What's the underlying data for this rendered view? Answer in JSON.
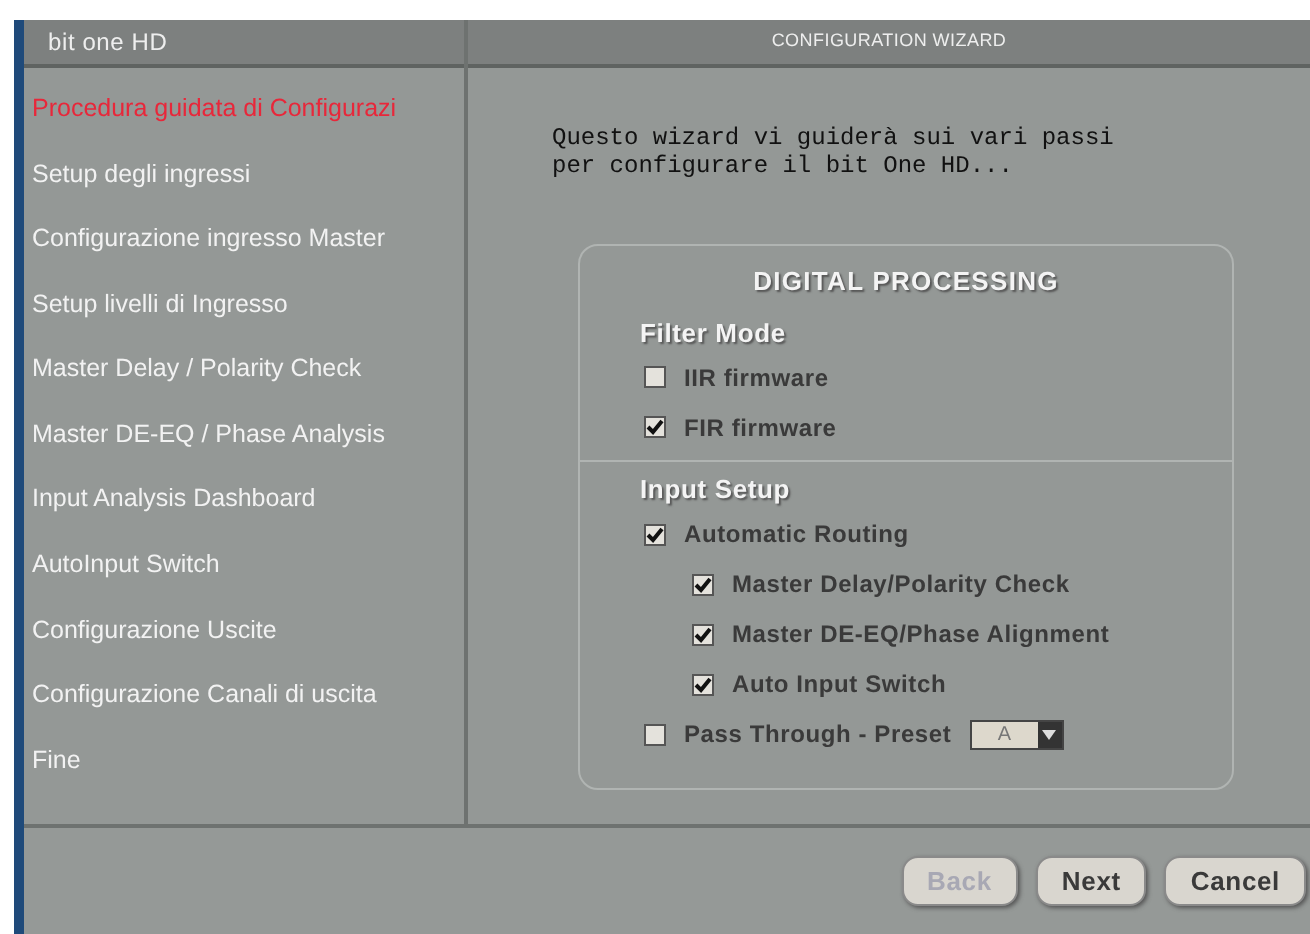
{
  "app_title": "bit one HD",
  "window": {
    "title": "CONFIGURATION WIZARD"
  },
  "sidebar": {
    "items": [
      {
        "label": "Procedura guidata di Configurazi",
        "selected": true
      },
      {
        "label": "Setup degli ingressi",
        "selected": false
      },
      {
        "label": "Configurazione ingresso Master",
        "selected": false
      },
      {
        "label": "Setup livelli di Ingresso",
        "selected": false
      },
      {
        "label": "Master Delay / Polarity Check",
        "selected": false
      },
      {
        "label": "Master DE-EQ / Phase Analysis",
        "selected": false
      },
      {
        "label": "Input Analysis Dashboard",
        "selected": false
      },
      {
        "label": "AutoInput Switch",
        "selected": false
      },
      {
        "label": "Configurazione Uscite",
        "selected": false
      },
      {
        "label": "Configurazione Canali di uscita",
        "selected": false
      },
      {
        "label": "Fine",
        "selected": false
      }
    ]
  },
  "intro": [
    "Questo wizard vi guiderà sui vari passi",
    "per configurare il bit One HD..."
  ],
  "panel": {
    "title": "DIGITAL PROCESSING",
    "sections": [
      {
        "title": "Filter Mode",
        "options": [
          {
            "label": "IIR firmware",
            "checked": false
          },
          {
            "label": "FIR firmware",
            "checked": true
          }
        ]
      },
      {
        "title": "Input Setup",
        "options": [
          {
            "label": "Automatic Routing",
            "checked": true,
            "children": [
              {
                "label": "Master Delay/Polarity Check",
                "checked": true
              },
              {
                "label": "Master DE-EQ/Phase Alignment",
                "checked": true
              },
              {
                "label": "Auto Input Switch",
                "checked": true
              }
            ]
          },
          {
            "label": "Pass Through - Preset",
            "checked": false,
            "dropdown": {
              "value": "A"
            }
          }
        ]
      }
    ]
  },
  "buttons": [
    {
      "label": "Back",
      "disabled": true
    },
    {
      "label": "Next",
      "disabled": false
    },
    {
      "label": "Cancel",
      "disabled": false
    }
  ]
}
